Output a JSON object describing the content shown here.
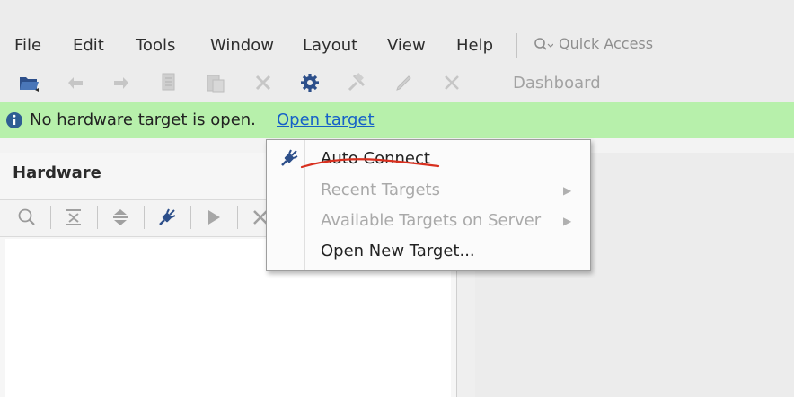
{
  "menubar": {
    "items": [
      {
        "label": "File"
      },
      {
        "label": "Edit"
      },
      {
        "label": "Tools"
      },
      {
        "label": "Window"
      },
      {
        "label": "Layout"
      },
      {
        "label": "View"
      },
      {
        "label": "Help"
      }
    ],
    "quick_access_placeholder": "Quick Access"
  },
  "toolbar": {
    "icons": [
      "open-project-icon",
      "undo-icon",
      "redo-icon",
      "copy-icon",
      "paste-icon",
      "delete-icon",
      "settings-icon",
      "program-device-icon",
      "edit-icon",
      "cancel-icon"
    ],
    "dashboard_label": "Dashboard"
  },
  "banner": {
    "message": "No hardware target is open.",
    "link": "Open target",
    "color": "#b7f0ab"
  },
  "hardware_panel": {
    "title": "Hardware",
    "toolbar_icons": [
      "search-icon",
      "collapse-all-icon",
      "expand-all-icon",
      "auto-connect-icon",
      "run-icon",
      "close-icon"
    ]
  },
  "popup_menu": {
    "items": [
      {
        "label": "Auto Connect",
        "enabled": true,
        "icon": "auto-connect-icon"
      },
      {
        "label": "Recent Targets",
        "enabled": false,
        "submenu": true
      },
      {
        "label": "Available Targets on Server",
        "enabled": false,
        "submenu": true
      },
      {
        "label": "Open New Target...",
        "enabled": true
      }
    ]
  }
}
